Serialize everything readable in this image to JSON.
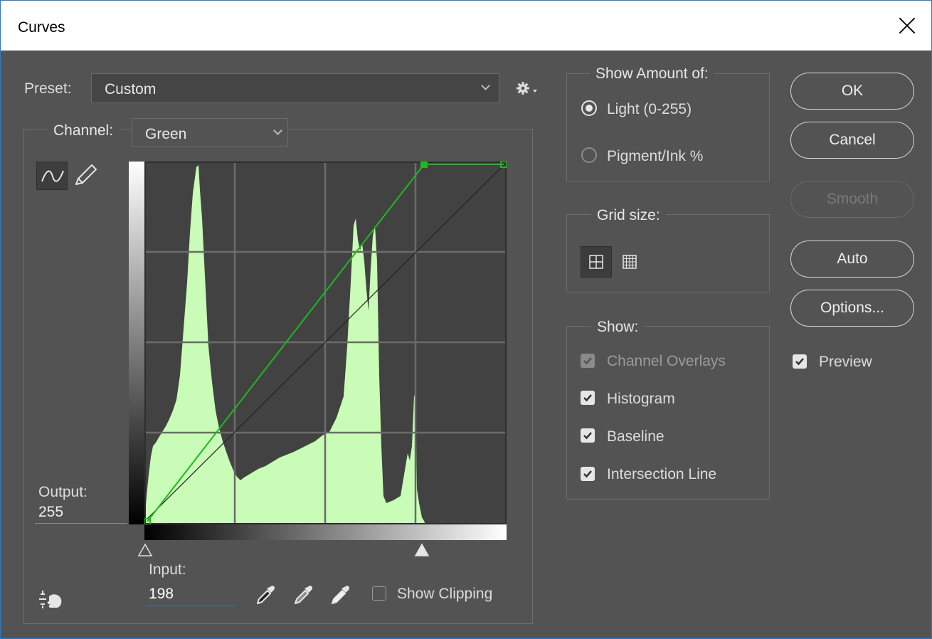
{
  "window": {
    "title": "Curves"
  },
  "preset": {
    "label": "Preset:",
    "value": "Custom"
  },
  "channel": {
    "label": "Channel:",
    "value": "Green"
  },
  "output": {
    "label": "Output:",
    "value": "255"
  },
  "input": {
    "label": "Input:",
    "value": "198"
  },
  "show_clipping": {
    "label": "Show Clipping",
    "checked": false
  },
  "show_amount": {
    "title": "Show Amount of:",
    "light_label": "Light  (0-255)",
    "pigment_label": "Pigment/Ink %",
    "selected": "light"
  },
  "grid_size": {
    "title": "Grid size:",
    "selected": "simple"
  },
  "show": {
    "title": "Show:",
    "channel_overlays": {
      "label": "Channel Overlays",
      "checked": true,
      "disabled": true
    },
    "histogram": {
      "label": "Histogram",
      "checked": true
    },
    "baseline": {
      "label": "Baseline",
      "checked": true
    },
    "intersection_line": {
      "label": "Intersection Line",
      "checked": true
    }
  },
  "buttons": {
    "ok": "OK",
    "cancel": "Cancel",
    "smooth": "Smooth",
    "auto": "Auto",
    "options": "Options..."
  },
  "preview": {
    "label": "Preview",
    "checked": true
  },
  "curve": {
    "points": [
      [
        0,
        0
      ],
      [
        198,
        255
      ],
      [
        255,
        255
      ]
    ],
    "color": "#1fb81f",
    "histogram_color": "#c9fcb6"
  },
  "icons": [
    "curve-mode-icon",
    "pencil-icon",
    "gear-icon",
    "on-image-adjust-icon",
    "black-eyedropper-icon",
    "gray-eyedropper-icon",
    "white-eyedropper-icon"
  ]
}
